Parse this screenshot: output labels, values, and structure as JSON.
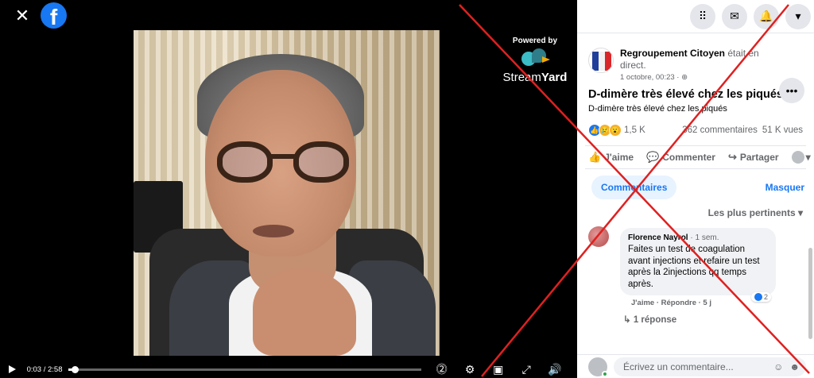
{
  "video": {
    "powered_by": "Powered by",
    "brand_part1": "Stream",
    "brand_part2": "Yard",
    "time": "0:03 / 2:58",
    "progress": 0.017
  },
  "header": {
    "close_icon": "close-icon",
    "logo_icon": "facebook-logo-icon"
  },
  "topbar": {
    "icons": [
      "menu-grid-icon",
      "messenger-icon",
      "notifications-bell-icon",
      "account-dropdown-icon"
    ]
  },
  "post": {
    "author": "Regroupement Citoyen",
    "status": " était en direct.",
    "timestamp": "1 octobre, 00:23 · ",
    "title": "D-dimère très élevé chez les piqués",
    "description": "D-dimère très élevé chez les piqués",
    "reaction_count": "1,5 K",
    "comments_count": "362 commentaires",
    "views": "51 K vues"
  },
  "actions": {
    "like": "J'aime",
    "comment": "Commenter",
    "share": "Partager"
  },
  "comments_section": {
    "tab": "Commentaires",
    "hide": "Masquer",
    "sort": "Les plus pertinents"
  },
  "comment": {
    "name": "Florence Nayrol",
    "age": " · 1 sem.",
    "text": "Faites un test de coagulation avant injections et refaire un test après la 2injections qq temps après.",
    "like_count": "2",
    "meta": "J'aime · Répondre · 5 j",
    "replies": "1 réponse"
  },
  "composer": {
    "placeholder": "Écrivez un commentaire..."
  },
  "colors": {
    "accent": "#1877f2",
    "cross": "#e02020"
  }
}
